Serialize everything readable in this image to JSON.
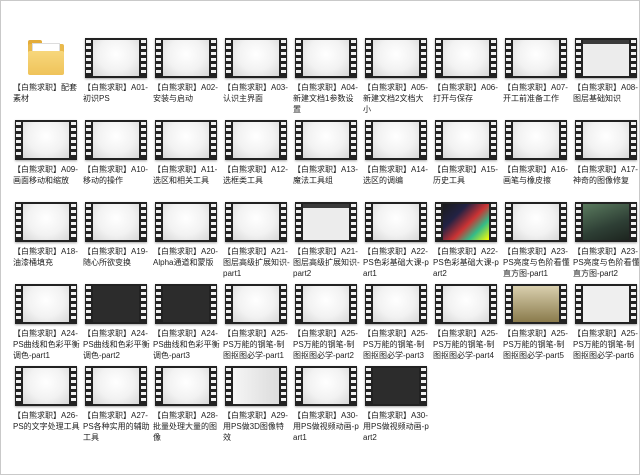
{
  "folder_view": {
    "items": [
      {
        "label": "【白熊求职】配套素材",
        "thumb": "folder",
        "icon": "folder-icon"
      },
      {
        "label": "【白熊求职】A01-初识PS",
        "thumb": "light",
        "icon": "video-file-icon"
      },
      {
        "label": "【白熊求职】A02-安装与启动",
        "thumb": "light",
        "icon": "video-file-icon"
      },
      {
        "label": "【白熊求职】A03-认识主界面",
        "thumb": "light",
        "icon": "video-file-icon"
      },
      {
        "label": "【白熊求职】A04-新建文档1参数设置",
        "thumb": "light",
        "icon": "video-file-icon"
      },
      {
        "label": "【白熊求职】A05-新建文档2文档大小",
        "thumb": "light",
        "icon": "video-file-icon"
      },
      {
        "label": "【白熊求职】A06-打开与保存",
        "thumb": "light",
        "icon": "video-file-icon"
      },
      {
        "label": "【白熊求职】A07-开工前准备工作",
        "thumb": "light",
        "icon": "video-file-icon"
      },
      {
        "label": "【白熊求职】A08-图层基础知识",
        "thumb": "ui",
        "icon": "video-file-icon"
      },
      {
        "label": "【白熊求职】A09-画面移动和缩放",
        "thumb": "light",
        "icon": "video-file-icon"
      },
      {
        "label": "【白熊求职】A10-移动的操作",
        "thumb": "light",
        "icon": "video-file-icon"
      },
      {
        "label": "【白熊求职】A11-选区和相关工具",
        "thumb": "light",
        "icon": "video-file-icon"
      },
      {
        "label": "【白熊求职】A12-选框类工具",
        "thumb": "light",
        "icon": "video-file-icon"
      },
      {
        "label": "【白熊求职】A13-魔法工具组",
        "thumb": "light",
        "icon": "video-file-icon"
      },
      {
        "label": "【白熊求职】A14-选区的调编",
        "thumb": "light",
        "icon": "video-file-icon"
      },
      {
        "label": "【白熊求职】A15-历史工具",
        "thumb": "light",
        "icon": "video-file-icon"
      },
      {
        "label": "【白熊求职】A16-画笔与橡皮擦",
        "thumb": "light",
        "icon": "video-file-icon"
      },
      {
        "label": "【白熊求职】A17-神奇的图像修复",
        "thumb": "light",
        "icon": "video-file-icon"
      },
      {
        "label": "【白熊求职】A18-油漆桶填充",
        "thumb": "light",
        "icon": "video-file-icon"
      },
      {
        "label": "【白熊求职】A19-随心所欲变换",
        "thumb": "light",
        "icon": "video-file-icon"
      },
      {
        "label": "【白熊求职】A20-Alpha通道和蒙版",
        "thumb": "light",
        "icon": "video-file-icon"
      },
      {
        "label": "【白熊求职】A21-图层高级扩展知识-part1",
        "thumb": "light",
        "icon": "video-file-icon"
      },
      {
        "label": "【白熊求职】A21-图层高级扩展知识-part2",
        "thumb": "ui",
        "icon": "video-file-icon"
      },
      {
        "label": "【白熊求职】A22-PS色彩基础大课-part1",
        "thumb": "light",
        "icon": "video-file-icon"
      },
      {
        "label": "【白熊求职】A22-PS色彩基础大课-part2",
        "thumb": "color",
        "icon": "video-file-icon"
      },
      {
        "label": "【白熊求职】A23-PS亮度与色阶看懂直方图-part1",
        "thumb": "light",
        "icon": "video-file-icon"
      },
      {
        "label": "【白熊求职】A23-PS亮度与色阶看懂直方图-part2",
        "thumb": "photo",
        "icon": "video-file-icon"
      },
      {
        "label": "【白熊求职】A24-PS曲线和色彩平衡调色-part1",
        "thumb": "light",
        "icon": "video-file-icon"
      },
      {
        "label": "【白熊求职】A24-PS曲线和色彩平衡调色-part2",
        "thumb": "dark",
        "icon": "video-file-icon"
      },
      {
        "label": "【白熊求职】A24-PS曲线和色彩平衡调色-part3",
        "thumb": "dark",
        "icon": "video-file-icon"
      },
      {
        "label": "【白熊求职】A25-PS万能的钢笔-制图抠图必学-part1",
        "thumb": "light",
        "icon": "video-file-icon"
      },
      {
        "label": "【白熊求职】A25-PS万能的钢笔-制图抠图必学-part2",
        "thumb": "light",
        "icon": "video-file-icon"
      },
      {
        "label": "【白熊求职】A25-PS万能的钢笔-制图抠图必学-part3",
        "thumb": "light",
        "icon": "video-file-icon"
      },
      {
        "label": "【白熊求职】A25-PS万能的钢笔-制图抠图必学-part4",
        "thumb": "light",
        "icon": "video-file-icon"
      },
      {
        "label": "【白熊求职】A25-PS万能的钢笔-制图抠图必学-part5",
        "thumb": "photo2",
        "icon": "video-file-icon"
      },
      {
        "label": "【白熊求职】A25-PS万能的钢笔-制图抠图必学-part6",
        "thumb": "heart",
        "icon": "video-file-icon"
      },
      {
        "label": "【白熊求职】A26-PS的文字处理工具",
        "thumb": "light",
        "icon": "video-file-icon"
      },
      {
        "label": "【白熊求职】A27-PS各种实用的辅助工具",
        "thumb": "light",
        "icon": "video-file-icon"
      },
      {
        "label": "【白熊求职】A28-批量处理大量的图像",
        "thumb": "light",
        "icon": "video-file-icon"
      },
      {
        "label": "【白熊求职】A29-用PS做3D图像特效",
        "thumb": "fadebar",
        "icon": "video-file-icon"
      },
      {
        "label": "【白熊求职】A30-用PS做视频动画-part1",
        "thumb": "light",
        "icon": "video-file-icon"
      },
      {
        "label": "【白熊求职】A30-用PS做视频动画-part2",
        "thumb": "dark",
        "icon": "video-file-icon"
      }
    ]
  }
}
